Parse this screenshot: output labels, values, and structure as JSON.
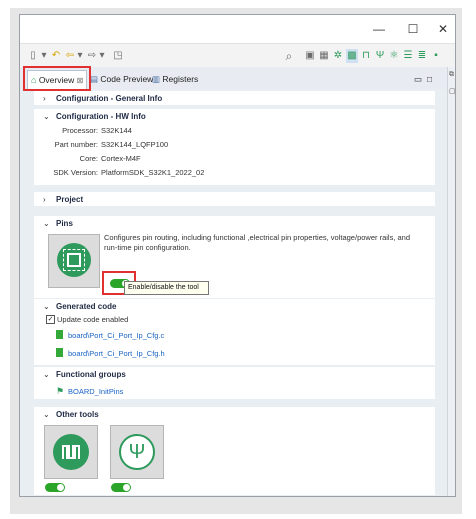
{
  "window": {
    "controls": {
      "minimize": "—",
      "maximize": "☐",
      "close": "✕"
    }
  },
  "tabs": [
    {
      "label": "Overview",
      "close": "⊠"
    },
    {
      "label": "Code Preview"
    },
    {
      "label": "Registers"
    }
  ],
  "sections": {
    "general_info": {
      "title": "Configuration - General Info"
    },
    "hw_info": {
      "title": "Configuration - HW Info",
      "rows": [
        {
          "label": "Processor:",
          "value": "S32K144"
        },
        {
          "label": "Part number:",
          "value": "S32K144_LQFP100"
        },
        {
          "label": "Core:",
          "value": "Cortex-M4F"
        },
        {
          "label": "SDK Version:",
          "value": "PlatformSDK_S32K1_2022_02"
        }
      ]
    },
    "project": {
      "title": "Project"
    },
    "pins": {
      "title": "Pins",
      "description": "Configures pin routing, including functional ,electrical pin properties, voltage/power rails, and run-time pin configuration.",
      "enabled": true,
      "tooltip": "Enable/disable the tool"
    },
    "generated_code": {
      "title": "Generated code",
      "update_label": "Update code enabled",
      "update_checked": true,
      "files": [
        "board\\Port_Ci_Port_Ip_Cfg.c",
        "board\\Port_Ci_Port_Ip_Cfg.h"
      ]
    },
    "functional_groups": {
      "title": "Functional groups",
      "items": [
        "BOARD_InitPins"
      ]
    },
    "other_tools": {
      "title": "Other tools",
      "tools": [
        {
          "name": "Peripherals",
          "enabled": true
        },
        {
          "name": "USB",
          "enabled": true
        }
      ]
    }
  },
  "colors": {
    "accent_green": "#2aa52a",
    "highlight_red": "#e03030",
    "link_blue": "#1b64c4",
    "tile_green": "#2e9a5c"
  }
}
